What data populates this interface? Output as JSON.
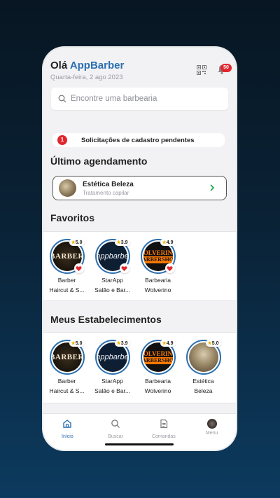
{
  "header": {
    "greeting_prefix": "Olá",
    "brand": "AppBarber",
    "date": "Quarta-feira, 2 ago 2023",
    "notification_count": "50"
  },
  "search": {
    "placeholder": "Encontre uma barbearia"
  },
  "pending": {
    "count": "1",
    "text": "Solicitações de cadastro pendentes"
  },
  "last_booking": {
    "title": "Último agendamento",
    "name": "Estética Beleza",
    "service": "Tratamento capilar"
  },
  "favorites": {
    "title": "Favoritos",
    "items": [
      {
        "rating": "5.0",
        "line1": "Barber",
        "line2": "Haircut & S...",
        "logo": "BARBER"
      },
      {
        "rating": "3.9",
        "line1": "StarApp",
        "line2": "Salão e Bar...",
        "logo": "appbarbe"
      },
      {
        "rating": "4.9",
        "line1": "Barbearia",
        "line2": "Wolverino",
        "logo1": "OLVERIN",
        "logo2": "ARBERSHO"
      }
    ]
  },
  "establishments": {
    "title": "Meus Estabelecimentos",
    "items": [
      {
        "rating": "5.0",
        "line1": "Barber",
        "line2": "Haircut & S...",
        "logo": "BARBER"
      },
      {
        "rating": "3.9",
        "line1": "StarApp",
        "line2": "Salão e Bar...",
        "logo": "appbarbe"
      },
      {
        "rating": "4.9",
        "line1": "Barbearia",
        "line2": "Wolverino",
        "logo1": "OLVERIN",
        "logo2": "ARBERSHO"
      },
      {
        "rating": "5.0",
        "line1": "Estética",
        "line2": "Beleza"
      }
    ]
  },
  "tabs": [
    {
      "label": "Início",
      "icon": "home-icon",
      "active": true
    },
    {
      "label": "Buscar",
      "icon": "search-icon"
    },
    {
      "label": "Comandas",
      "icon": "document-icon"
    },
    {
      "label": "Menu",
      "icon": "avatar"
    }
  ],
  "colors": {
    "brand": "#2a6fb0",
    "badge": "#e3262e",
    "star": "#f5b400"
  }
}
